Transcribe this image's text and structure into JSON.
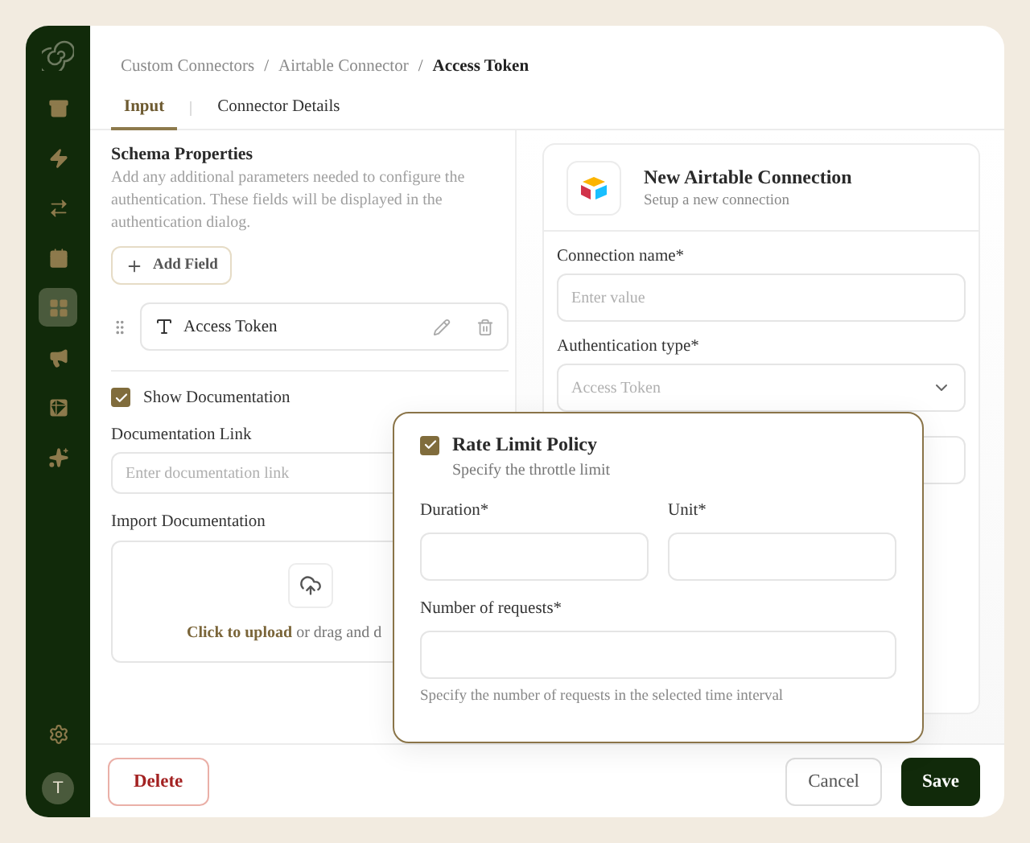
{
  "sidebar": {
    "items": [
      {
        "kind": "archive",
        "selected": false
      },
      {
        "kind": "bolt",
        "selected": false
      },
      {
        "kind": "transfer",
        "selected": false
      },
      {
        "kind": "calendar",
        "selected": false
      },
      {
        "kind": "grid",
        "selected": true
      },
      {
        "kind": "megaphone",
        "selected": false
      },
      {
        "kind": "table",
        "selected": false
      },
      {
        "kind": "sparkle",
        "selected": false
      }
    ],
    "avatar": "T"
  },
  "breadcrumb": {
    "separator": "/",
    "items": [
      {
        "label": "Custom Connectors",
        "current": false
      },
      {
        "label": "Airtable Connector",
        "current": false
      },
      {
        "label": "Access Token",
        "current": true
      }
    ]
  },
  "tabs": [
    {
      "label": "Input",
      "selected": true
    },
    {
      "label": "Connector Details",
      "selected": false
    }
  ],
  "schema": {
    "title": "Schema Properties",
    "description": "Add any additional parameters needed to configure the authentication. These fields will be displayed in the authentication dialog.",
    "add_button": "Add Field",
    "fields": [
      {
        "name": "Access Token"
      }
    ]
  },
  "show_documentation": {
    "label": "Show Documentation",
    "checked": true
  },
  "documentation_link": {
    "label": "Documentation Link",
    "placeholder": "Enter documentation link"
  },
  "import_documentation": {
    "label": "Import Documentation",
    "link": "Click to upload",
    "rest": "or drag and d"
  },
  "connection": {
    "title": "New Airtable Connection",
    "subtitle": "Setup a new connection",
    "fields": [
      {
        "kind": "input",
        "label": "Connection name*",
        "placeholder": "Enter value"
      },
      {
        "kind": "select",
        "label": "Authentication type*",
        "value": "Access Token"
      },
      {
        "kind": "input"
      }
    ]
  },
  "popover": {
    "title": "Rate Limit Policy",
    "checked": true,
    "subtitle": "Specify the throttle limit",
    "fields": [
      {
        "kind": "half",
        "label": "Duration*"
      },
      {
        "kind": "half",
        "label": "Unit*"
      },
      {
        "kind": "full",
        "label": "Number of requests*"
      }
    ],
    "hint": "Specify the number of requests in the selected time interval"
  },
  "footer": {
    "delete": "Delete",
    "cancel": "Cancel",
    "save": "Save"
  }
}
